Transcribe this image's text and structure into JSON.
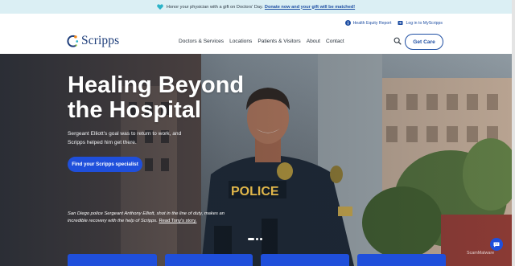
{
  "announcement": {
    "lead": "Honor your physician with a gift on Doctors' Day.",
    "link": "Donate now and your gift will be matched!"
  },
  "utility": {
    "health_equity": "Health Equity Report",
    "login": "Log in to MyScripps"
  },
  "brand": {
    "name": "Scripps"
  },
  "nav": {
    "items": [
      "Doctors & Services",
      "Locations",
      "Patients & Visitors",
      "About",
      "Contact"
    ],
    "get_care": "Get Care"
  },
  "hero": {
    "title": "Healing Beyond the Hospital",
    "body": "Sergeant Elliott's goal was to return to work, and Scripps helped him get there.",
    "cta": "Find your Scripps specialist",
    "caption": "San Diego police Sergeant Anthony Elliott, shot in the line of duty, makes an incredible recovery with the help of Scripps.",
    "caption_link": "Read Tony's story.",
    "badge_text": "POLICE",
    "slides_total": 3,
    "slide_active": 1
  },
  "watermark": "ScamMalware",
  "colors": {
    "brand_blue": "#1f4fa3",
    "cta_blue": "#1f4fdb",
    "announce_bg": "#dbeff4",
    "heart_teal": "#2bb3c8"
  },
  "icons": [
    "heart-icon",
    "info-icon",
    "login-icon",
    "search-icon",
    "chat-icon"
  ]
}
